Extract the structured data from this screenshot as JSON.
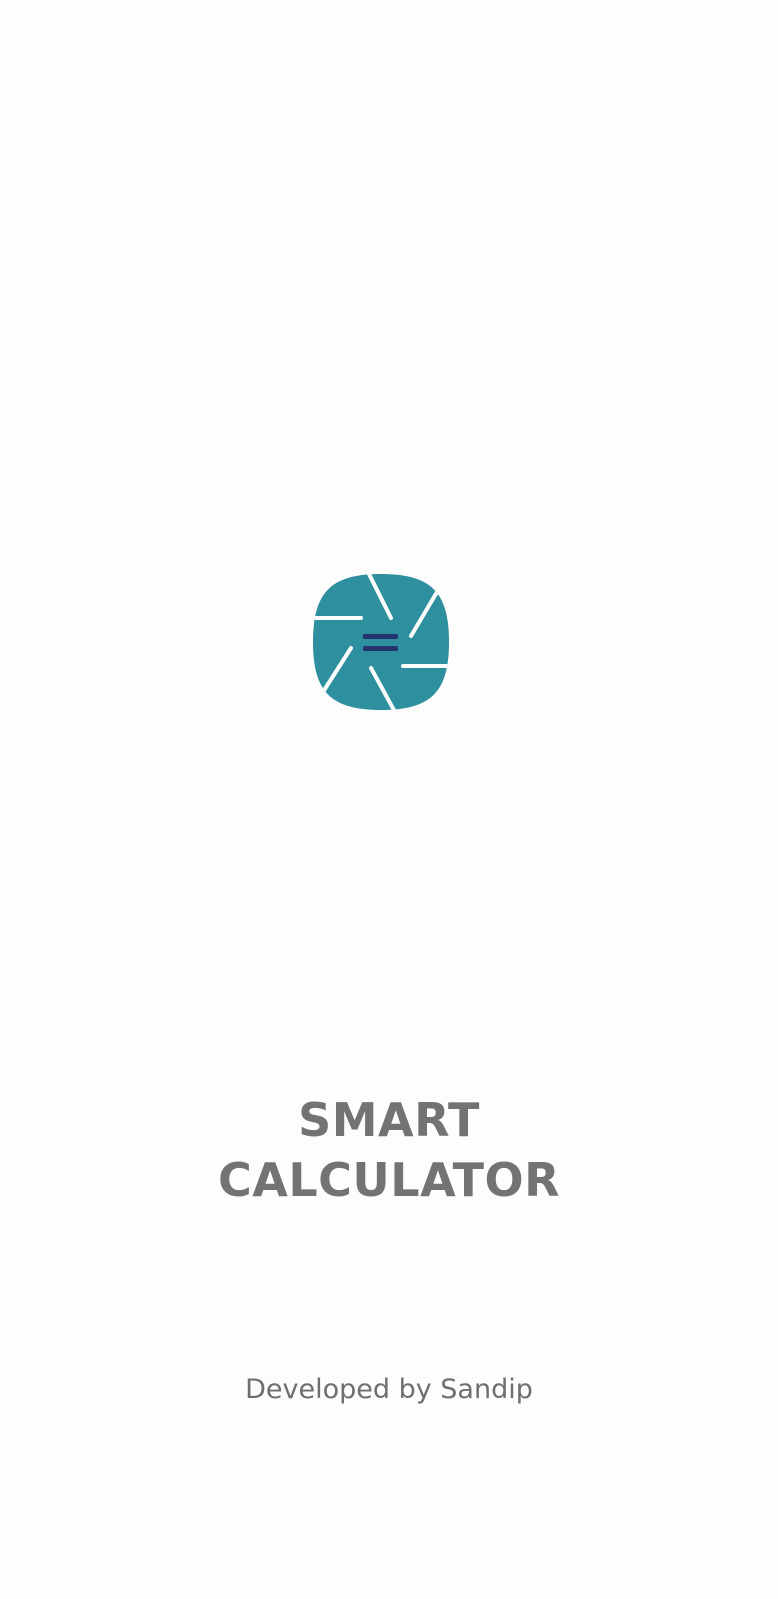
{
  "splash": {
    "logo_icon": "calculator-aperture-logo-icon",
    "title_line_1": "SMART",
    "title_line_2": "CALCULATOR",
    "credit": "Developed by Sandip"
  },
  "colors": {
    "background": "#fdfdfd",
    "logo_primary": "#2e8f9e",
    "logo_equals": "#25336e",
    "text": "#737373"
  }
}
